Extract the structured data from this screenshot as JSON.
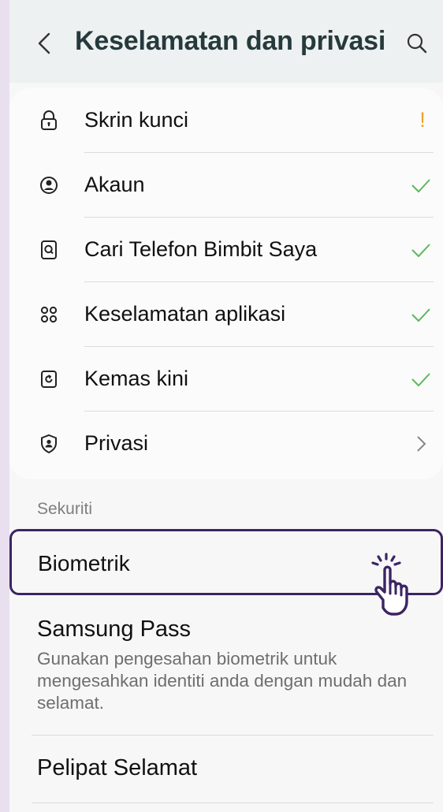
{
  "header": {
    "title": "Keselamatan dan privasi"
  },
  "status_items": [
    {
      "label": "Skrin kunci",
      "icon": "lock-icon",
      "status": "warning"
    },
    {
      "label": "Akaun",
      "icon": "account-icon",
      "status": "ok"
    },
    {
      "label": "Cari Telefon Bimbit Saya",
      "icon": "find-phone-icon",
      "status": "ok"
    },
    {
      "label": "Keselamatan aplikasi",
      "icon": "apps-icon",
      "status": "ok"
    },
    {
      "label": "Kemas kini",
      "icon": "update-icon",
      "status": "ok"
    },
    {
      "label": "Privasi",
      "icon": "privacy-shield-icon",
      "status": "chevron"
    }
  ],
  "status_marks": {
    "warning": "!"
  },
  "section": {
    "label": "Sekuriti"
  },
  "biometrik": {
    "label": "Biometrik"
  },
  "samsung_pass": {
    "title": "Samsung Pass",
    "description": "Gunakan pengesahan biometrik untuk mengesahkan identiti anda dengan mudah dan selamat."
  },
  "pelipat": {
    "title": "Pelipat Selamat"
  },
  "colors": {
    "title": "#263a3d",
    "check": "#5cb85c",
    "warning": "#f0a020",
    "highlight": "#3c2463"
  }
}
